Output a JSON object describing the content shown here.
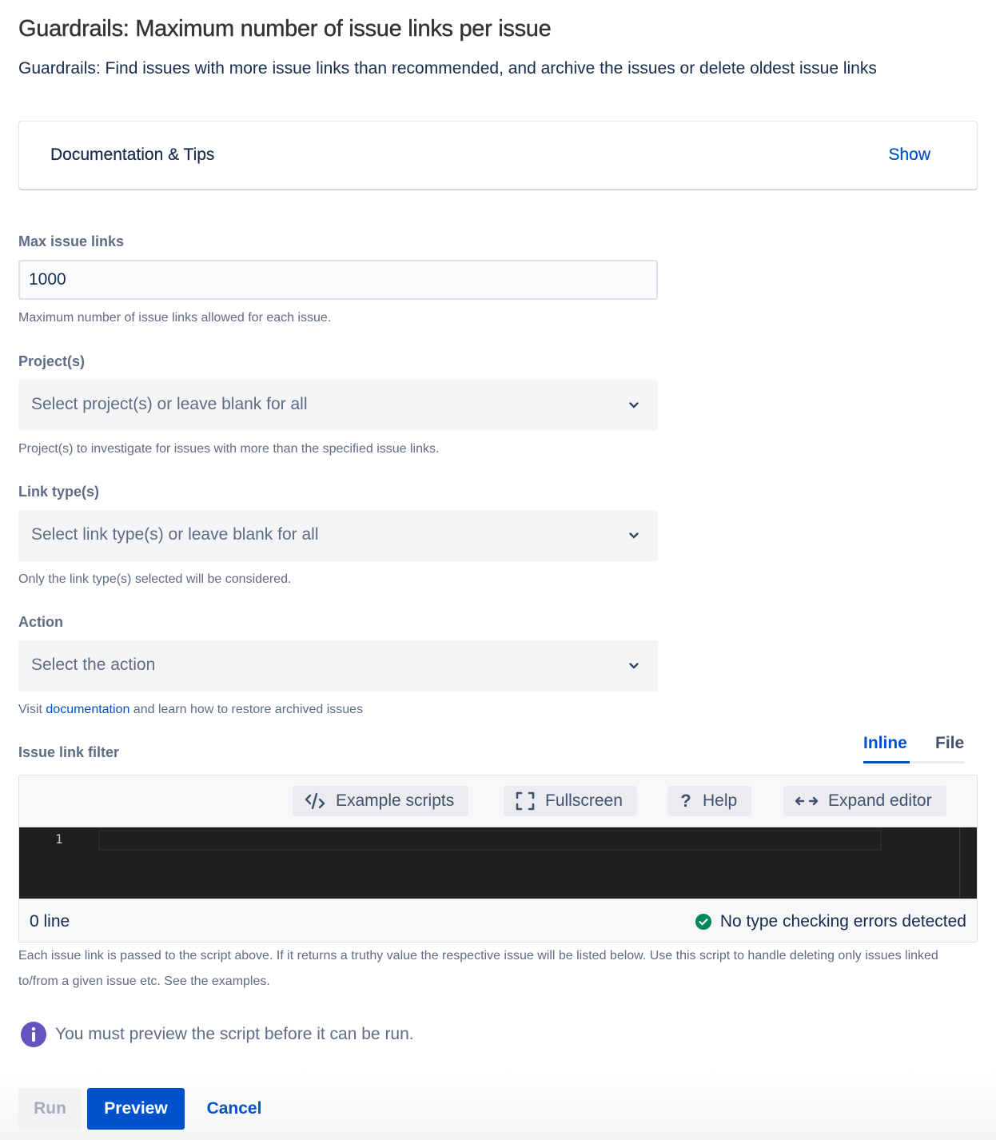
{
  "page": {
    "title": "Guardrails: Maximum number of issue links per issue",
    "subtitle": "Guardrails: Find issues with more issue links than recommended, and archive the issues or delete oldest issue links"
  },
  "documentation_panel": {
    "title": "Documentation & Tips",
    "toggle_label": "Show"
  },
  "form": {
    "max_issue_links": {
      "label": "Max issue links",
      "value": "1000",
      "helper": "Maximum number of issue links allowed for each issue."
    },
    "projects": {
      "label": "Project(s)",
      "placeholder": "Select project(s) or leave blank for all",
      "helper": "Project(s) to investigate for issues with more than the specified issue links."
    },
    "link_types": {
      "label": "Link type(s)",
      "placeholder": "Select link type(s) or leave blank for all",
      "helper": "Only the link type(s) selected will be considered."
    },
    "action": {
      "label": "Action",
      "placeholder": "Select the action",
      "helper_prefix": "Visit ",
      "helper_link": "documentation",
      "helper_suffix": " and learn how to restore archived issues"
    },
    "issue_link_filter": {
      "label": "Issue link filter",
      "tabs": [
        {
          "label": "Inline",
          "active": true
        },
        {
          "label": "File",
          "active": false
        }
      ],
      "toolbar": {
        "example_scripts": {
          "label": "Example scripts",
          "icon": "code-icon"
        },
        "fullscreen": {
          "label": "Fullscreen",
          "icon": "fullscreen-icon"
        },
        "help": {
          "label": "Help",
          "icon": "question-icon"
        },
        "expand_editor": {
          "label": "Expand editor",
          "icon": "expand-horizontal-icon"
        }
      },
      "line_numbers": [
        "1"
      ],
      "code": "",
      "status": {
        "line_count": "0 line",
        "type_check": "No type checking errors detected",
        "type_check_color": "#00875a"
      },
      "helper": "Each issue link is passed to the script above. If it returns a truthy value the respective issue will be listed below. Use this script to handle deleting only issues linked to/from a given issue etc. See the examples."
    }
  },
  "notice": {
    "icon": "info-icon",
    "icon_color": "#6554c0",
    "text": "You must preview the script before it can be run."
  },
  "actions": {
    "run": {
      "label": "Run",
      "disabled": true
    },
    "preview": {
      "label": "Preview",
      "color": "#0052cc"
    },
    "cancel": {
      "label": "Cancel"
    }
  }
}
